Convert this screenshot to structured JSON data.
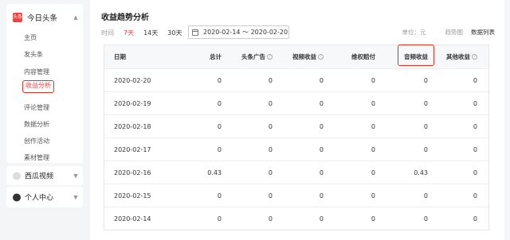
{
  "sidebar": {
    "brand": {
      "logo_text": "头条",
      "name": "今日头条"
    },
    "items": [
      {
        "label": "主页"
      },
      {
        "label": "发头条"
      },
      {
        "label": "内容管理"
      },
      {
        "label": "收益分析"
      },
      {
        "label": "评论管理"
      },
      {
        "label": "数据分析"
      },
      {
        "label": "创作活动"
      },
      {
        "label": "素材管理"
      }
    ],
    "active_item": "收益分析",
    "sections": [
      {
        "label": "西瓜视频"
      },
      {
        "label": "个人中心"
      }
    ]
  },
  "main": {
    "title": "收益趋势分析",
    "filters": {
      "time_label": "时间",
      "ranges": [
        "7天",
        "14天",
        "30天"
      ],
      "active_range": "7天",
      "date_range": "2020-02-14 ～ 2020-02-20"
    },
    "unit_label": "单位：元",
    "views": [
      "趋势图",
      "数据列表"
    ],
    "active_view": "数据列表"
  },
  "table": {
    "columns": [
      "日期",
      "总计",
      "头条广告",
      "视频收益",
      "维权赔付",
      "音频收益",
      "其他收益"
    ],
    "help_columns": [
      2,
      3,
      6
    ],
    "highlighted_column": "音频收益",
    "rows": [
      [
        "2020-02-20",
        "0",
        "0",
        "0",
        "0",
        "0",
        "0"
      ],
      [
        "2020-02-19",
        "0",
        "0",
        "0",
        "0",
        "0",
        "0"
      ],
      [
        "2020-02-18",
        "0",
        "0",
        "0",
        "0",
        "0",
        "0"
      ],
      [
        "2020-02-17",
        "0",
        "0",
        "0",
        "0",
        "0",
        "0"
      ],
      [
        "2020-02-16",
        "0.43",
        "0",
        "0",
        "0",
        "0.43",
        "0"
      ],
      [
        "2020-02-15",
        "0",
        "0",
        "0",
        "0",
        "0",
        "0"
      ],
      [
        "2020-02-14",
        "0",
        "0",
        "0",
        "0",
        "0",
        "0"
      ]
    ]
  },
  "colors": {
    "accent": "#f04142",
    "annotation": "#e0301e"
  }
}
